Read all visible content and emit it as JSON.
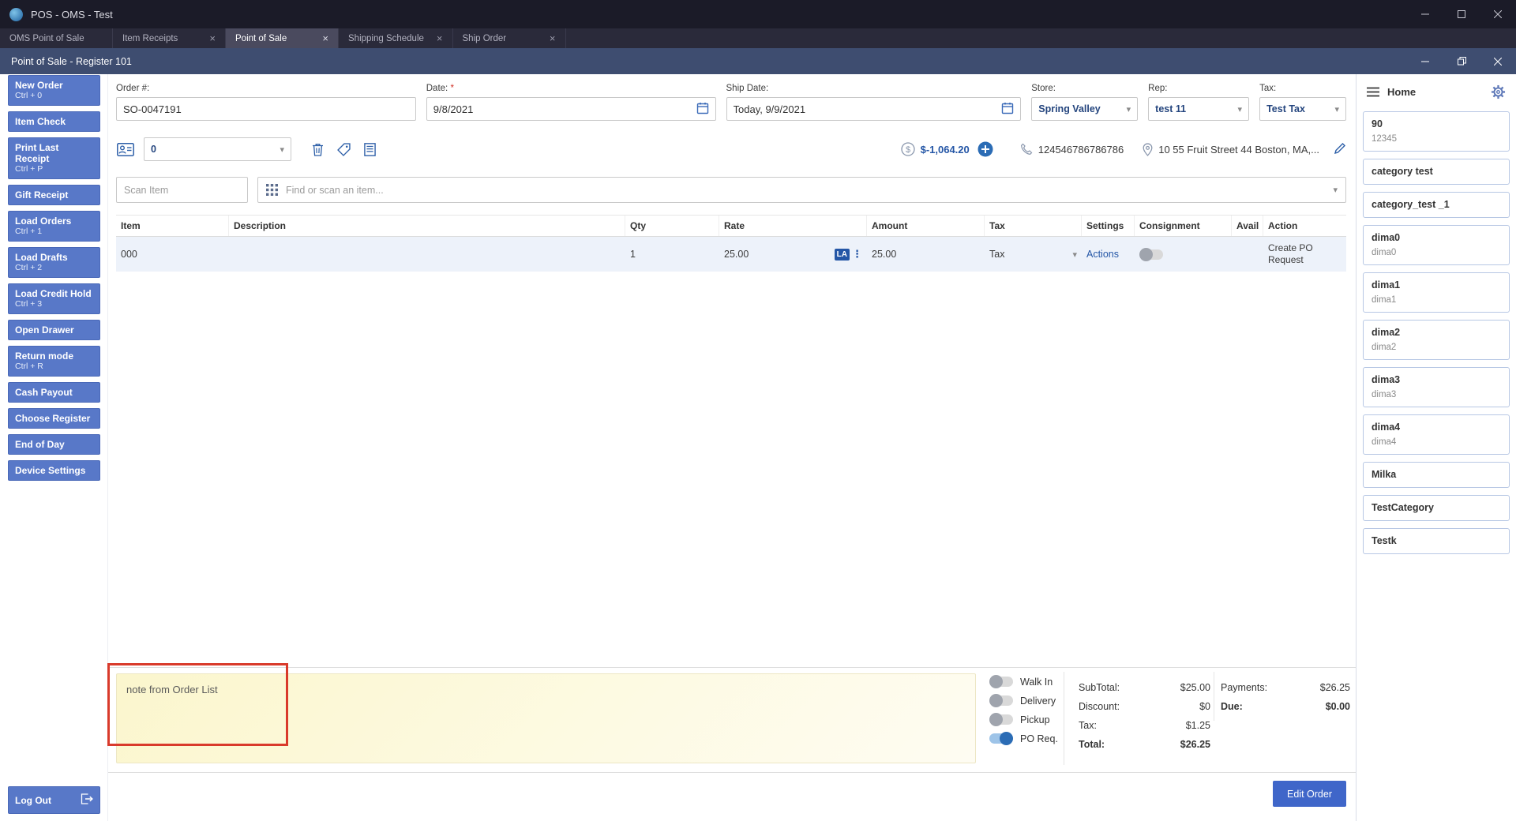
{
  "os_window": {
    "title": "POS - OMS - Test"
  },
  "tabs": [
    {
      "label": "OMS Point of Sale",
      "active": false
    },
    {
      "label": "Item Receipts",
      "active": false
    },
    {
      "label": "Point of Sale",
      "active": true
    },
    {
      "label": "Shipping Schedule",
      "active": false
    },
    {
      "label": "Ship Order",
      "active": false
    }
  ],
  "register_bar": {
    "title": "Point of Sale - Register 101"
  },
  "sidebar": {
    "buttons": [
      {
        "label": "New Order",
        "shortcut": "Ctrl + 0"
      },
      {
        "label": "Item Check",
        "shortcut": ""
      },
      {
        "label": "Print Last Receipt",
        "shortcut": "Ctrl + P"
      },
      {
        "label": "Gift Receipt",
        "shortcut": ""
      },
      {
        "label": "Load Orders",
        "shortcut": "Ctrl + 1"
      },
      {
        "label": "Load Drafts",
        "shortcut": "Ctrl + 2"
      },
      {
        "label": "Load Credit Hold",
        "shortcut": "Ctrl + 3"
      },
      {
        "label": "Open Drawer",
        "shortcut": ""
      },
      {
        "label": "Return mode",
        "shortcut": "Ctrl + R"
      },
      {
        "label": "Cash Payout",
        "shortcut": ""
      },
      {
        "label": "Choose Register",
        "shortcut": ""
      },
      {
        "label": "End of Day",
        "shortcut": ""
      },
      {
        "label": "Device Settings",
        "shortcut": ""
      }
    ],
    "logout_label": "Log Out"
  },
  "order_form": {
    "order_label": "Order #:",
    "order_value": "SO-0047191",
    "date_label": "Date:",
    "date_required": "*",
    "date_value": "9/8/2021",
    "ship_date_label": "Ship Date:",
    "ship_date_value": "Today, 9/9/2021",
    "store_label": "Store:",
    "store_value": "Spring Valley",
    "rep_label": "Rep:",
    "rep_value": "test 11",
    "tax_label": "Tax:",
    "tax_value": "Test Tax"
  },
  "toolbar": {
    "customer_select_value": "0",
    "balance": "$-1,064.20",
    "phone": "124546786786786",
    "address": "10 55 Fruit Street 44 Boston, MA,..."
  },
  "search": {
    "scan_placeholder": "Scan Item",
    "find_placeholder": "Find or scan an item..."
  },
  "items_table": {
    "columns": [
      "Item",
      "Description",
      "Qty",
      "Rate",
      "Amount",
      "Tax",
      "Settings",
      "Consignment",
      "Avail",
      "Action"
    ],
    "rows": [
      {
        "item": "000",
        "description": "",
        "qty": "1",
        "rate": "25.00",
        "rate_badge": "LA",
        "amount": "25.00",
        "tax": "Tax",
        "settings": "Actions",
        "consignment_on": false,
        "avail": "",
        "action": "Create PO Request"
      }
    ]
  },
  "note": {
    "text": "note from Order List"
  },
  "fulfillment": {
    "options": [
      {
        "label": "Walk In",
        "on": false
      },
      {
        "label": "Delivery",
        "on": false
      },
      {
        "label": "Pickup",
        "on": false
      },
      {
        "label": "PO Req.",
        "on": true
      }
    ]
  },
  "totals": {
    "subtotal_label": "SubTotal:",
    "subtotal": "$25.00",
    "discount_label": "Discount:",
    "discount": "$0",
    "tax_label": "Tax:",
    "tax": "$1.25",
    "total_label": "Total:",
    "total": "$26.25",
    "payments_label": "Payments:",
    "payments": "$26.25",
    "due_label": "Due:",
    "due": "$0.00"
  },
  "footer": {
    "edit_order_label": "Edit Order"
  },
  "right_panel": {
    "home_label": "Home",
    "categories": [
      {
        "title": "90",
        "subtitle": "12345"
      },
      {
        "title": "category test",
        "subtitle": ""
      },
      {
        "title": "category_test _1",
        "subtitle": ""
      },
      {
        "title": "dima0",
        "subtitle": "dima0"
      },
      {
        "title": "dima1",
        "subtitle": "dima1"
      },
      {
        "title": "dima2",
        "subtitle": "dima2"
      },
      {
        "title": "dima3",
        "subtitle": "dima3"
      },
      {
        "title": "dima4",
        "subtitle": "dima4"
      },
      {
        "title": "Milka",
        "subtitle": ""
      },
      {
        "title": "TestCategory",
        "subtitle": ""
      },
      {
        "title": "Testk",
        "subtitle": ""
      }
    ]
  },
  "icons": {
    "close": "×",
    "chevron_down": "▾",
    "menu_dots": "⋮"
  },
  "colors": {
    "accent_blue": "#2456a6",
    "button_blue": "#5878c8",
    "toggle_on_blue": "#2b6cb5",
    "titlebar_dark": "#1b1b28",
    "register_bar_navy": "#3e4d70",
    "note_yellow": "#fbf6cd",
    "annotation_red": "#d93a2b"
  }
}
